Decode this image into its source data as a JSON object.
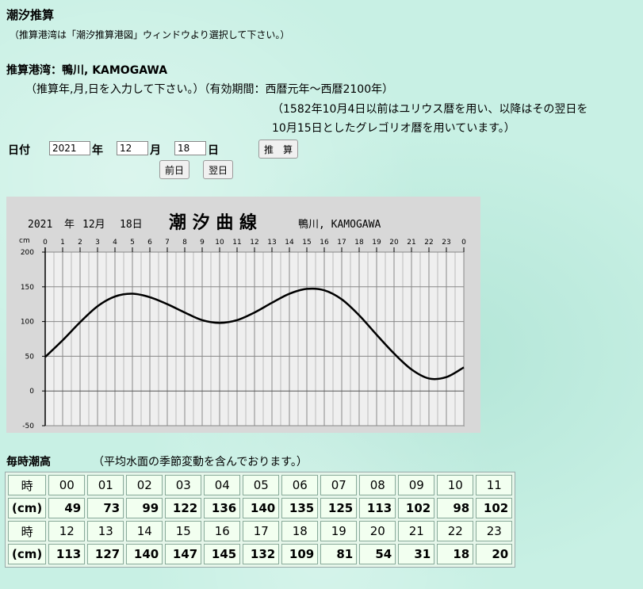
{
  "page": {
    "title": "潮汐推算",
    "subtitle": "（推算港湾は「潮汐推算港図」ウィンドウより選択して下さい。）",
    "port_label": "推算港湾：鴨川, KAMOGAWA",
    "instruction": "（推算年,月,日を入力して下さい。）（有効期間：西暦元年〜西暦2100年）",
    "note_line1": "（1582年10月4日以前はユリウス暦を用い、以降はその翌日を",
    "note_line2": "10月15日としたグレゴリオ暦を用いています。）"
  },
  "form": {
    "date_label": "日付",
    "year_value": "2021",
    "year_unit": "年",
    "month_value": "12",
    "month_unit": "月",
    "day_value": "18",
    "day_unit": "日",
    "compute_button": "推　算",
    "prev_button": "前日",
    "next_button": "翌日"
  },
  "chart_data": {
    "type": "line",
    "title": "潮 汐 曲 線",
    "date_year": "2021",
    "year_unit": "年",
    "date_month": "12月",
    "date_day": "18日",
    "port": "鴨川, KAMOGAWA",
    "ylabel": "cm",
    "xlim": [
      0,
      24
    ],
    "ylim": [
      -50,
      200
    ],
    "yticks": [
      -50,
      0,
      50,
      100,
      150,
      200
    ],
    "xtick_labels": [
      "0",
      "1",
      "2",
      "3",
      "4",
      "5",
      "6",
      "7",
      "8",
      "9",
      "10",
      "11",
      "12",
      "13",
      "14",
      "15",
      "16",
      "17",
      "18",
      "19",
      "20",
      "21",
      "22",
      "23",
      "0"
    ],
    "x": [
      0,
      1,
      2,
      3,
      4,
      5,
      6,
      7,
      8,
      9,
      10,
      11,
      12,
      13,
      14,
      15,
      16,
      17,
      18,
      19,
      20,
      21,
      22,
      23,
      24
    ],
    "y": [
      49,
      73,
      99,
      122,
      136,
      140,
      135,
      125,
      113,
      102,
      98,
      102,
      113,
      127,
      140,
      147,
      145,
      132,
      109,
      81,
      54,
      31,
      18,
      20,
      34
    ],
    "grid": true,
    "line_color": "#000000",
    "plot_background": "#efefef",
    "frame_background": "#d8d8d8"
  },
  "table": {
    "section_title": "毎時潮高",
    "section_note": "（平均水面の季節変動を含んでおります。）",
    "hour_label": "時",
    "value_label": "(cm)",
    "row1_hours": [
      "00",
      "01",
      "02",
      "03",
      "04",
      "05",
      "06",
      "07",
      "08",
      "09",
      "10",
      "11"
    ],
    "row1_values": [
      "49",
      "73",
      "99",
      "122",
      "136",
      "140",
      "135",
      "125",
      "113",
      "102",
      "98",
      "102"
    ],
    "row2_hours": [
      "12",
      "13",
      "14",
      "15",
      "16",
      "17",
      "18",
      "19",
      "20",
      "21",
      "22",
      "23"
    ],
    "row2_values": [
      "113",
      "127",
      "140",
      "147",
      "145",
      "132",
      "109",
      "81",
      "54",
      "31",
      "18",
      "20"
    ]
  }
}
